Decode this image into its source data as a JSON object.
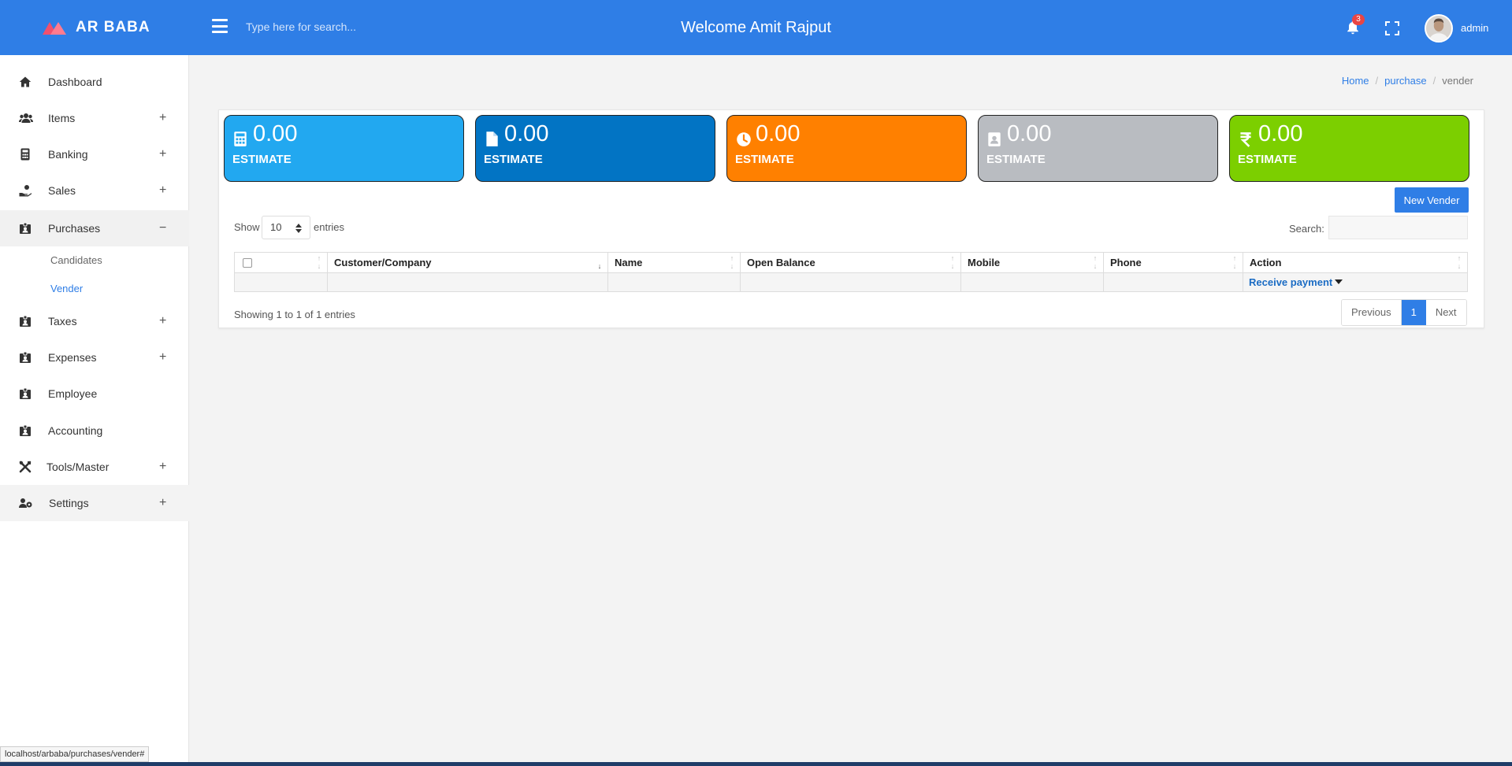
{
  "header": {
    "brand": "AR BABA",
    "search_placeholder": "Type here for search...",
    "welcome": "Welcome Amit Rajput",
    "notification_count": "3",
    "user_label": "admin",
    "accent_color": "#2f7ee6"
  },
  "sidebar": {
    "items": [
      {
        "label": "Dashboard",
        "icon": "home-icon"
      },
      {
        "label": "Items",
        "icon": "users-icon",
        "expander": "+"
      },
      {
        "label": "Banking",
        "icon": "calculator-icon",
        "expander": "+"
      },
      {
        "label": "Sales",
        "icon": "hand-coin-icon",
        "expander": "+"
      },
      {
        "label": "Purchases",
        "icon": "id-badge-icon",
        "expander": "−"
      },
      {
        "label": "Taxes",
        "icon": "id-badge-icon",
        "expander": "+"
      },
      {
        "label": "Expenses",
        "icon": "id-badge-icon",
        "expander": "+"
      },
      {
        "label": "Employee",
        "icon": "id-badge-icon"
      },
      {
        "label": "Accounting",
        "icon": "id-badge-icon"
      },
      {
        "label": "Tools/Master",
        "icon": "tools-icon",
        "expander": "+"
      },
      {
        "label": "Settings",
        "icon": "users-cog-icon",
        "expander": "+"
      }
    ],
    "subitems": [
      {
        "label": "Candidates"
      },
      {
        "label": "Vender"
      }
    ]
  },
  "breadcrumb": {
    "home": "Home",
    "section": "purchase",
    "current": "vender",
    "separator": "/"
  },
  "stats": [
    {
      "value": "0.00",
      "label": "ESTIMATE",
      "icon": "calculator-icon",
      "color": "#22a8f0"
    },
    {
      "value": "0.00",
      "label": "ESTIMATE",
      "icon": "file-icon",
      "color": "#0274c4"
    },
    {
      "value": "0.00",
      "label": "ESTIMATE",
      "icon": "clock-icon",
      "color": "#ff8000"
    },
    {
      "value": "0.00",
      "label": "ESTIMATE",
      "icon": "contact-card-icon",
      "color": "#b9bcc1"
    },
    {
      "value": "0.00",
      "label": "ESTIMATE",
      "icon": "rupee-icon",
      "color": "#7ccf00"
    }
  ],
  "new_button": "New Vender",
  "table_controls": {
    "show": "Show",
    "entries_value": "10",
    "entries": "entries",
    "search_label": "Search:"
  },
  "table": {
    "columns": [
      "",
      "Customer/Company",
      "Name",
      "Open Balance",
      "Mobile",
      "Phone",
      "Action"
    ],
    "row_action": "Receive payment",
    "info": "Showing 1 to 1 of 1 entries"
  },
  "pagination": {
    "previous": "Previous",
    "current": "1",
    "next": "Next"
  },
  "status_url": "localhost/arbaba/purchases/vender#"
}
